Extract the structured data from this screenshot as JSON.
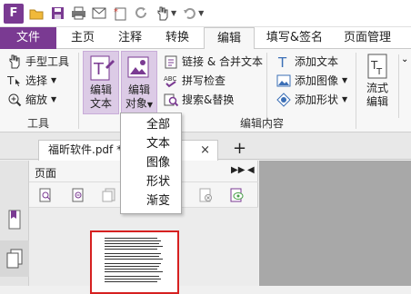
{
  "quick_access": {
    "app_logo": "F",
    "icons": [
      "open-folder-icon",
      "save-icon",
      "print-icon",
      "email-icon",
      "new-blank-icon",
      "redo-circle-icon",
      "hand-select-icon",
      "undo-icon"
    ]
  },
  "tabs": [
    {
      "label": "文件",
      "active": false
    },
    {
      "label": "主页",
      "active": false
    },
    {
      "label": "注释",
      "active": false
    },
    {
      "label": "转换",
      "active": false
    },
    {
      "label": "编辑",
      "active": true
    },
    {
      "label": "填写&签名",
      "active": false
    },
    {
      "label": "页面管理",
      "active": false
    }
  ],
  "ribbon": {
    "tools_group": {
      "hand_tool": "手型工具",
      "select": "选择",
      "zoom": "缩放",
      "label": "工具"
    },
    "edit_text": [
      "编辑",
      "文本"
    ],
    "edit_object": [
      "编辑",
      "对象"
    ],
    "link_merge": "链接 & 合并文本",
    "spell_check": "拼写检查",
    "search_replace": "搜索&替换",
    "add_text": "添加文本",
    "add_image": "添加图像",
    "add_shape": "添加形状",
    "flow": [
      "流式",
      "编辑"
    ],
    "edit_content_label": "编辑内容"
  },
  "document_tab": {
    "name": "福昕软件.pdf *",
    "close": "×",
    "new_tab": "+"
  },
  "page_panel": {
    "title": "页面"
  },
  "edit_object_menu": {
    "items": [
      "全部",
      "文本",
      "图像",
      "形状",
      "渐变"
    ]
  },
  "colors": {
    "brand_purple": "#7a3a92",
    "thumbnail_border": "#d62020"
  }
}
